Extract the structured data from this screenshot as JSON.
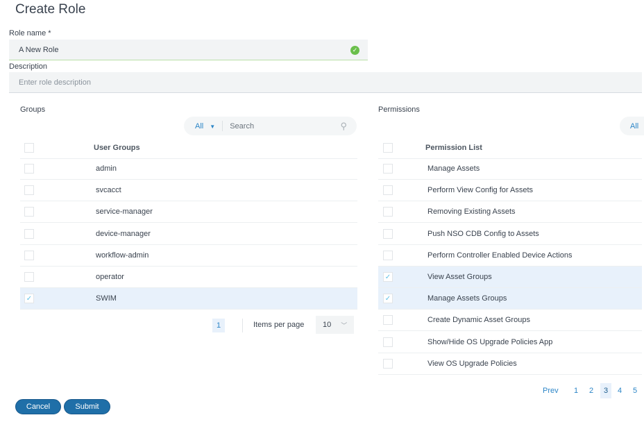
{
  "title": "Create Role",
  "role_name": {
    "label": "Role name *",
    "value": "A New Role"
  },
  "description": {
    "label": "Description",
    "placeholder": "Enter role description"
  },
  "groups": {
    "label": "Groups",
    "filter": "All",
    "search_placeholder": "Search",
    "column": "User Groups",
    "rows": [
      {
        "name": "admin",
        "checked": false
      },
      {
        "name": "svcacct",
        "checked": false
      },
      {
        "name": "service-manager",
        "checked": false
      },
      {
        "name": "device-manager",
        "checked": false
      },
      {
        "name": "workflow-admin",
        "checked": false
      },
      {
        "name": "operator",
        "checked": false
      },
      {
        "name": "SWIM",
        "checked": true
      }
    ],
    "page": "1",
    "items_per_page_label": "Items per page",
    "items_per_page": "10"
  },
  "permissions": {
    "label": "Permissions",
    "filter": "All",
    "column": "Permission List",
    "rows": [
      {
        "name": "Manage Assets",
        "checked": false
      },
      {
        "name": "Perform View Config for Assets",
        "checked": false
      },
      {
        "name": "Removing Existing Assets",
        "checked": false
      },
      {
        "name": "Push NSO CDB Config to Assets",
        "checked": false
      },
      {
        "name": "Perform Controller Enabled Device Actions",
        "checked": false
      },
      {
        "name": "View Asset Groups",
        "checked": true
      },
      {
        "name": "Manage Assets Groups",
        "checked": true
      },
      {
        "name": "Create Dynamic Asset Groups",
        "checked": false
      },
      {
        "name": "Show/Hide OS Upgrade Policies App",
        "checked": false
      },
      {
        "name": "View OS Upgrade Policies",
        "checked": false
      }
    ],
    "pagination": {
      "prev": "Prev",
      "pages": [
        "1",
        "2",
        "3",
        "4",
        "5"
      ],
      "current": "3"
    }
  },
  "buttons": {
    "cancel": "Cancel",
    "submit": "Submit"
  }
}
